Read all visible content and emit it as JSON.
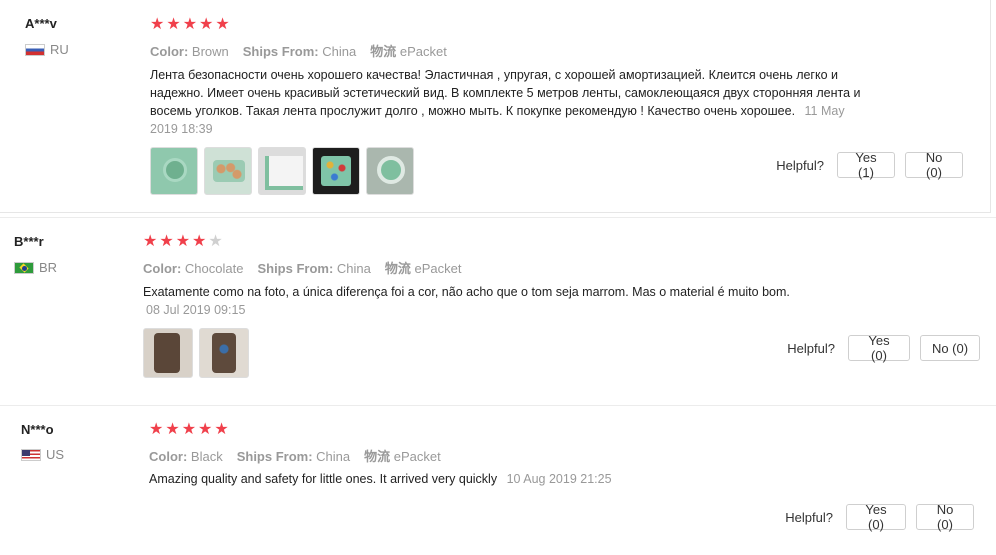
{
  "reviews": [
    {
      "user": "A***v",
      "country": "RU",
      "stars_filled": 5,
      "meta": {
        "color_label": "Color:",
        "color": "Brown",
        "ships_label": "Ships From:",
        "ships": "China",
        "logistics_label": "物流",
        "logistics": "ePacket"
      },
      "text": "Лента безопасности очень хорошего качества! Эластичная , упругая, с хорошей амортизацией. Клеится очень легко и надежно. Имеет очень красивый эстетический вид. В комплекте 5 метров ленты, самоклеющаяся двух сторонняя лента и восемь уголков. Такая лента прослужит долго , можно мыть. К покупке рекомендую ! Качество очень хорошее.",
      "date": "11 May 2019 18:39",
      "photos": 5,
      "helpful_label": "Helpful?",
      "yes": "Yes (1)",
      "no": "No (0)"
    },
    {
      "user": "B***r",
      "country": "BR",
      "stars_filled": 4,
      "meta": {
        "color_label": "Color:",
        "color": "Chocolate",
        "ships_label": "Ships From:",
        "ships": "China",
        "logistics_label": "物流",
        "logistics": "ePacket"
      },
      "text": "Exatamente como na foto, a única diferença foi a cor, não acho que o tom seja marrom. Mas o material é muito bom.",
      "date": "08 Jul 2019 09:15",
      "photos": 2,
      "helpful_label": "Helpful?",
      "yes": "Yes (0)",
      "no": "No (0)"
    },
    {
      "user": "N***o",
      "country": "US",
      "stars_filled": 5,
      "meta": {
        "color_label": "Color:",
        "color": "Black",
        "ships_label": "Ships From:",
        "ships": "China",
        "logistics_label": "物流",
        "logistics": "ePacket"
      },
      "text": "Amazing quality and safety for little ones. It arrived very quickly",
      "date": "10 Aug 2019 21:25",
      "photos": 0,
      "helpful_label": "Helpful?",
      "yes": "Yes (0)",
      "no": "No (0)"
    }
  ],
  "colors": {
    "star": "#f0404b",
    "star_off": "#d0d0d0",
    "meta": "#999999"
  }
}
